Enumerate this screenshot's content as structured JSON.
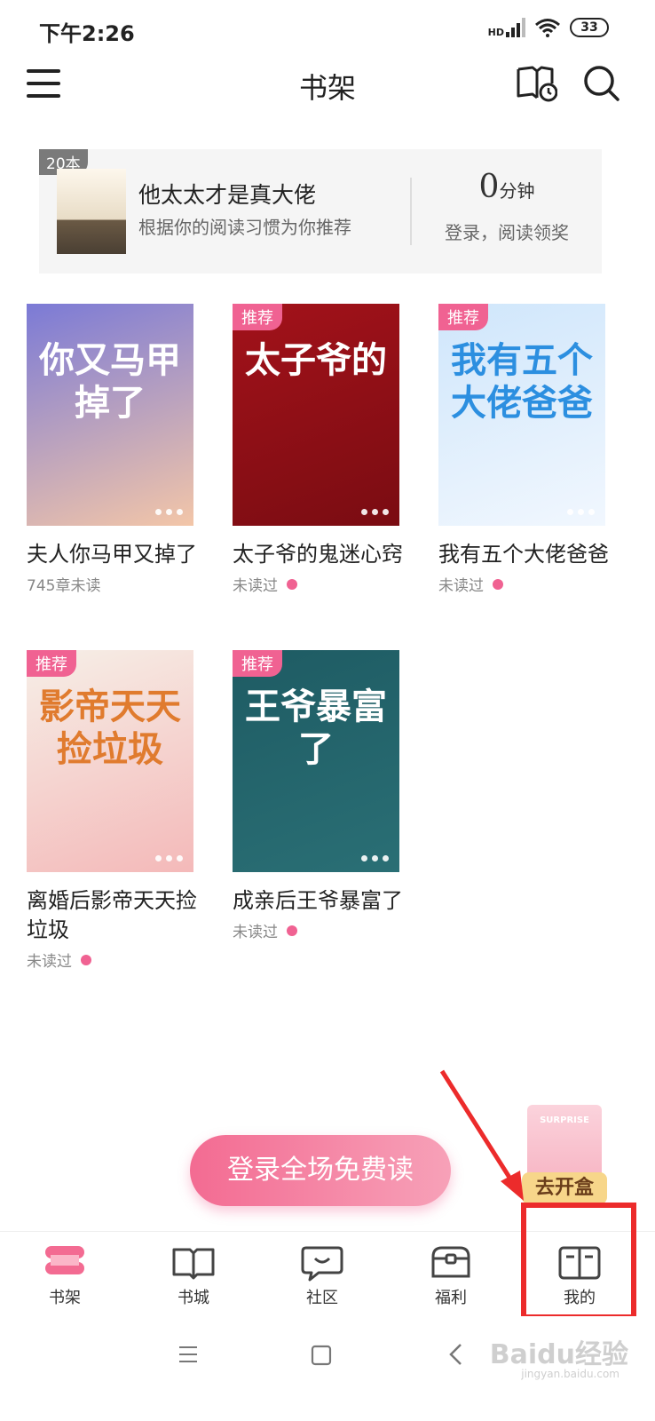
{
  "status_bar": {
    "time": "下午2:26",
    "hd": "HD",
    "battery": "33"
  },
  "header": {
    "title": "书架"
  },
  "banner": {
    "count_badge": "20本",
    "book_title": "他太太才是真大佬",
    "subtitle": "根据你的阅读习惯为你推荐",
    "minutes_value": "0",
    "minutes_unit": "分钟",
    "login_reward": "登录，阅读领奖"
  },
  "books": [
    {
      "title": "夫人你马甲又掉了",
      "status": "745章未读",
      "tag": "",
      "cover_text": "你又马甲掉了",
      "colors": [
        "#7b7ad6",
        "#f3c6a8"
      ],
      "new_dot": false
    },
    {
      "title": "太子爷的鬼迷心窍",
      "status": "未读过",
      "tag": "推荐",
      "cover_text": "太子爷的",
      "colors": [
        "#a3121a",
        "#7a0c12"
      ],
      "new_dot": true
    },
    {
      "title": "我有五个大佬爸爸",
      "status": "未读过",
      "tag": "推荐",
      "cover_text": "我有五个大佬爸爸",
      "colors": [
        "#cfe6fb",
        "#f1f7fe"
      ],
      "new_dot": true
    },
    {
      "title": "离婚后影帝天天捡垃圾",
      "status": "未读过",
      "tag": "推荐",
      "cover_text": "影帝天天捡垃圾",
      "colors": [
        "#f6efe7",
        "#f4b9b9"
      ],
      "new_dot": true
    },
    {
      "title": "成亲后王爷暴富了",
      "status": "未读过",
      "tag": "推荐",
      "cover_text": "王爷暴富了",
      "colors": [
        "#1e5b63",
        "#2a6f75"
      ],
      "new_dot": true
    }
  ],
  "floating": {
    "login_button": "登录全场免费读",
    "surprise_label": "去开盒",
    "surprise_word": "SURPRISE"
  },
  "tabbar": [
    {
      "label": "书架",
      "icon": "bookshelf-icon",
      "active": true
    },
    {
      "label": "书城",
      "icon": "open-book-icon",
      "active": false
    },
    {
      "label": "社区",
      "icon": "chat-bubble-icon",
      "active": false
    },
    {
      "label": "福利",
      "icon": "treasure-box-icon",
      "active": false
    },
    {
      "label": "我的",
      "icon": "profile-book-icon",
      "active": false
    }
  ],
  "watermark": {
    "text": "Baidu经验",
    "sub": "jingyan.baidu.com"
  },
  "colors": {
    "accent": "#f06292",
    "highlight": "#ec2b2b",
    "tab_active": "#f36b92"
  }
}
